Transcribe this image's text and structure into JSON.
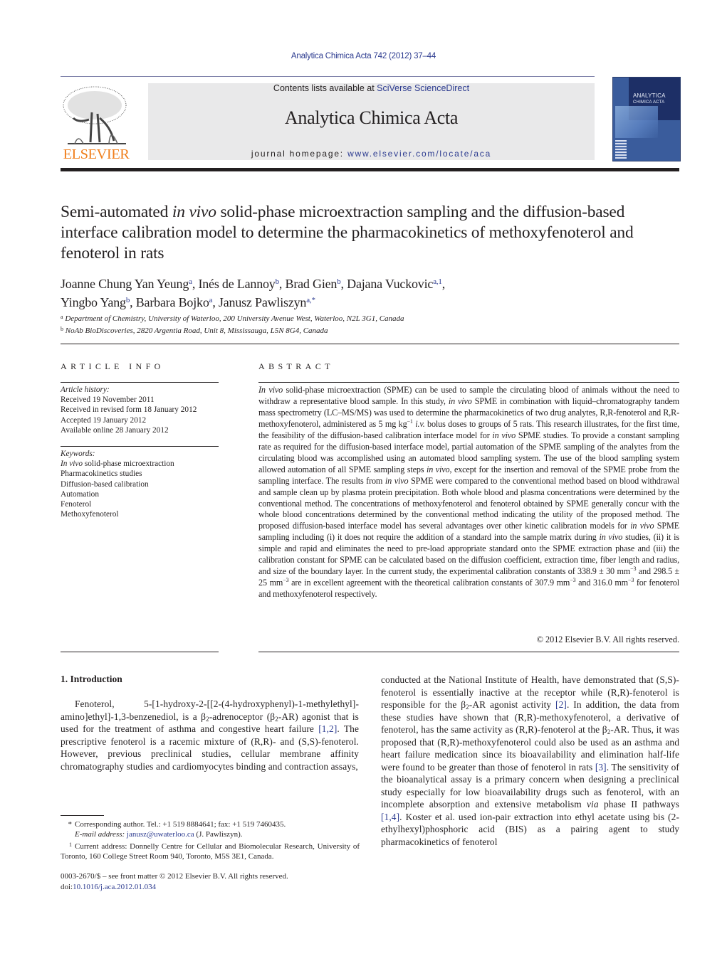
{
  "header": {
    "citation": "Analytica Chimica Acta 742 (2012) 37–44",
    "contents_prefix": "Contents lists available at ",
    "contents_link": "SciVerse ScienceDirect",
    "journal_title": "Analytica Chimica Acta",
    "homepage_prefix": "journal homepage: ",
    "homepage_link": "www.elsevier.com/locate/aca",
    "publisher_logo_text": "ELSEVIER",
    "cover_title_line1": "ANALYTICA",
    "cover_title_line2": "CHIMICA ACTA"
  },
  "article": {
    "title_part1": "Semi-automated ",
    "title_italic": "in vivo",
    "title_part2": " solid-phase microextraction sampling and the diffusion-based interface calibration model to determine the pharmacokinetics of methoxyfenoterol and fenoterol in rats",
    "authors": [
      {
        "name": "Joanne Chung Yan Yeung",
        "marks": "a",
        "sep": ", "
      },
      {
        "name": "Inés de Lannoy",
        "marks": "b",
        "sep": ", "
      },
      {
        "name": "Brad Gien",
        "marks": "b",
        "sep": ", "
      },
      {
        "name": "Dajana Vuckovic",
        "marks": "a,1",
        "sep": ","
      },
      {
        "name": "Yingbo Yang",
        "marks": "b",
        "sep": ", "
      },
      {
        "name": "Barbara Bojko",
        "marks": "a",
        "sep": ", "
      },
      {
        "name": "Janusz Pawliszyn",
        "marks": "a,*",
        "sep": ""
      }
    ],
    "affiliations": [
      {
        "mark": "a",
        "text": "Department of Chemistry, University of Waterloo, 200 University Avenue West, Waterloo, N2L 3G1, Canada"
      },
      {
        "mark": "b",
        "text": "NoAb BioDiscoveries, 2820 Argentia Road, Unit 8, Mississauga, L5N 8G4, Canada"
      }
    ]
  },
  "article_info": {
    "heading": "ARTICLE INFO",
    "history_label": "Article history:",
    "history": [
      "Received 19 November 2011",
      "Received in revised form 18 January 2012",
      "Accepted 19 January 2012",
      "Available online 28 January 2012"
    ],
    "keywords_label": "Keywords:",
    "keyword0_italic": "In vivo",
    "keyword0_rest": " solid-phase microextraction",
    "keywords": [
      "Pharmacokinetics studies",
      "Diffusion-based calibration",
      "Automation",
      "Fenoterol",
      "Methoxyfenoterol"
    ]
  },
  "abstract": {
    "heading": "ABSTRACT",
    "s1_i": "In vivo",
    "s1": " solid-phase microextraction (SPME) can be used to sample the circulating blood of animals without the need to withdraw a representative blood sample. In this study, ",
    "s2_i": "in vivo",
    "s2": " SPME in combination with liquid–chromatography tandem mass spectrometry (LC–MS/MS) was used to determine the pharmacokinetics of two drug analytes, R,R-fenoterol and R,R-methoxyfenoterol, administered as 5 mg kg",
    "s2_sup": "−1",
    "s3_i": " i.v.",
    "s3": " bolus doses to groups of 5 rats. This research illustrates, for the first time, the feasibility of the diffusion-based calibration interface model for ",
    "s4_i": "in vivo",
    "s4": " SPME studies. To provide a constant sampling rate as required for the diffusion-based interface model, partial automation of the SPME sampling of the analytes from the circulating blood was accomplished using an automated blood sampling system. The use of the blood sampling system allowed automation of all SPME sampling steps ",
    "s5_i": "in vivo",
    "s5": ", except for the insertion and removal of the SPME probe from the sampling interface. The results from ",
    "s6_i": "in vivo",
    "s6": " SPME were compared to the conventional method based on blood withdrawal and sample clean up by plasma protein precipitation. Both whole blood and plasma concentrations were determined by the conventional method. The concentrations of methoxyfenoterol and fenoterol obtained by SPME generally concur with the whole blood concentrations determined by the conventional method indicating the utility of the proposed method. The proposed diffusion-based interface model has several advantages over other kinetic calibration models for ",
    "s7_i": "in vivo",
    "s7": " SPME sampling including (i) it does not require the addition of a standard into the sample matrix during ",
    "s8_i": "in vivo",
    "s8": " studies, (ii) it is simple and rapid and eliminates the need to pre-load appropriate standard onto the SPME extraction phase and (iii) the calibration constant for SPME can be calculated based on the diffusion coefficient, extraction time, fiber length and radius, and size of the boundary layer. In the current study, the experimental calibration constants of 338.9 ± 30 mm",
    "s8_sup": "−3",
    "s9": " and 298.5 ± 25 mm",
    "s9_sup": "−3",
    "s10": " are in excellent agreement with the theoretical calibration constants of 307.9 mm",
    "s10_sup": "−3",
    "s11": " and 316.0 mm",
    "s11_sup": "−3",
    "s12": " for fenoterol and methoxyfenoterol respectively.",
    "copyright": "© 2012 Elsevier B.V. All rights reserved."
  },
  "introduction": {
    "heading": "1.  Introduction",
    "l1": "Fenoterol, 5-[1-hydroxy-2-[[2-(4-hydroxyphenyl)-1-methylethyl]-amino]ethyl]-1,3-benzenediol, is a β",
    "l1_sub": "2",
    "l2": "-adrenoceptor (β",
    "l2_sub": "2",
    "l3": "-AR) agonist that is used for the treatment of asthma and congestive heart failure ",
    "ref12": "[1,2]",
    "l4": ". The prescriptive fenoterol is a racemic mixture of (R,R)- and (S,S)-fenoterol. However, previous preclinical studies, cellular membrane affinity chromatography studies and cardiomyocytes binding and contraction assays,",
    "r1": "conducted at the National Institute of Health, have demonstrated that (S,S)-fenoterol is essentially inactive at the receptor while (R,R)-fenoterol is responsible for the β",
    "r1_sub": "2",
    "r2": "-AR agonist activity ",
    "ref2": "[2]",
    "r3": ". In addition, the data from these studies have shown that (R,R)-methoxyfenoterol, a derivative of fenoterol, has the same activity as (R,R)-fenoterol at the β",
    "r3_sub": "2",
    "r4": "-AR. Thus, it was proposed that (R,R)-methoxyfenoterol could also be used as an asthma and heart failure medication since its bioavailability and elimination half-life were found to be greater than those of fenoterol in rats ",
    "ref3": "[3]",
    "r5": ". The sensitivity of the bioanalytical assay is a primary concern when designing a preclinical study especially for low bioavailability drugs such as fenoterol, with an incomplete absorption and extensive metabolism ",
    "r5_i": "via",
    "r6": " phase II pathways ",
    "ref14": "[1,4]",
    "r7": ". Koster et al. used ion-pair extraction into ethyl acetate using bis (2-ethylhexyl)phosphoric acid (BIS) as a pairing agent to study pharmacokinetics of fenoterol"
  },
  "footnotes": {
    "star_mark": "*",
    "star_text": "Corresponding author. Tel.: +1 519 8884641; fax: +1 519 7460435.",
    "email_label": "E-mail address:",
    "email": "janusz@uwaterloo.ca",
    "email_suffix": " (J. Pawliszyn).",
    "one_mark": "1",
    "one_text": "Current address: Donnelly Centre for Cellular and Biomolecular Research, University of Toronto, 160 College Street Room 940, Toronto, M5S 3E1, Canada.",
    "front_matter": "0003-2670/$ – see front matter © 2012 Elsevier B.V. All rights reserved.",
    "doi_prefix": "doi:",
    "doi": "10.1016/j.aca.2012.01.034"
  }
}
